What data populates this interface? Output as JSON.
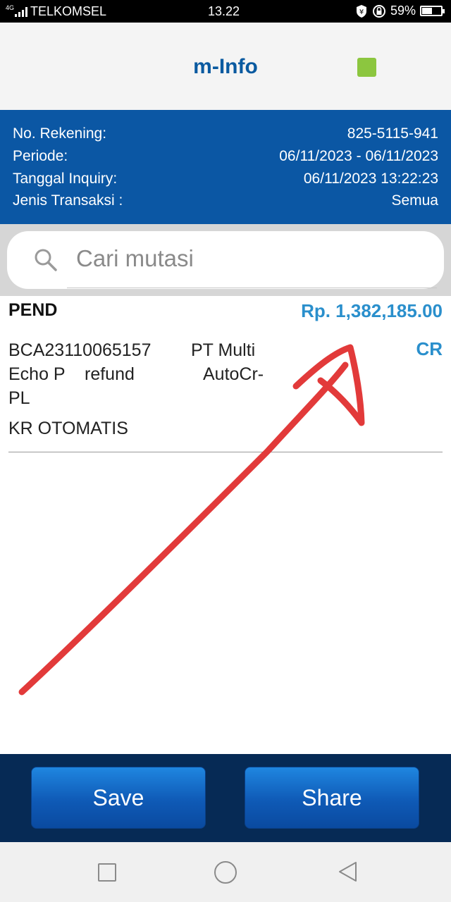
{
  "status_bar": {
    "network": "4G",
    "carrier": "TELKOMSEL",
    "time": "13.22",
    "battery": "59%"
  },
  "header": {
    "title": "m-Info"
  },
  "account_info": {
    "rows": [
      {
        "label": "No. Rekening:",
        "value": "825-5115-941"
      },
      {
        "label": "Periode:",
        "value": "06/11/2023 - 06/11/2023"
      },
      {
        "label": "Tanggal Inquiry:",
        "value": "06/11/2023 13:22:23"
      },
      {
        "label": "Jenis Transaksi :",
        "value": "Semua"
      }
    ]
  },
  "search": {
    "placeholder": "Cari mutasi"
  },
  "transaction": {
    "status": "PEND",
    "amount": "Rp. 1,382,185.00",
    "type": "CR",
    "desc": {
      "ref": "BCA23110065157",
      "company": "PT Multi",
      "company2": "Echo P",
      "note": "refund",
      "method": "AutoCr-",
      "method2": "PL"
    },
    "channel": "KR OTOMATIS"
  },
  "buttons": {
    "save": "Save",
    "share": "Share"
  },
  "colors": {
    "brand_blue": "#0b57a4",
    "accent_blue": "#2a8fcc",
    "footer": "#062a55",
    "annotation_red": "#e23a3a"
  },
  "icons": [
    "signal-icon",
    "shield-icon",
    "lock-rotation-icon",
    "battery-icon",
    "search-icon",
    "nav-recents-icon",
    "nav-home-icon",
    "nav-back-icon"
  ]
}
